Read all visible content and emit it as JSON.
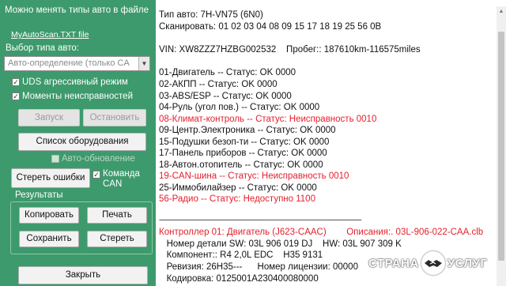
{
  "sidebar": {
    "hint_text": "Можно менять типы авто в файле",
    "hint_link": "MyAutoScan.TXT file",
    "type_label": "Выбор типа авто:",
    "type_select_value": "Авто-определение (только CA",
    "uds_checkbox_label": "UDS агрессивный режим",
    "uds_checked": true,
    "moments_checkbox_label": "Моменты неисправностей",
    "moments_checked": true,
    "start_button": "Запуск",
    "stop_button": "Остановить",
    "equipment_button": "Список оборудования",
    "auto_update_label": "Авто-обновление",
    "auto_update_checked": false,
    "clear_errors_button": "Стереть ошибки",
    "can_command_label": "Команда CAN",
    "can_command_checked": true,
    "results_group_label": "Результаты",
    "copy_button": "Копировать",
    "print_button": "Печать",
    "save_button": "Сохранить",
    "erase_button": "Стереть",
    "close_button": "Закрыть"
  },
  "log": {
    "car_type": "Тип авто: 7H-VN75 (6N0)",
    "scan_list": "Сканировать: 01 02 03 04 08 09 15 17 18 19 25 56 0B",
    "vin_line": "VIN: XW8ZZZ7HZBG002532    Пробег:: 187610km-116575miles",
    "modules": [
      {
        "text": "01-Двигатель -- Статус: OK 0000",
        "error": false
      },
      {
        "text": "02-АКПП -- Статус: OK 0000",
        "error": false
      },
      {
        "text": "03-ABS/ESP -- Статус: OK 0000",
        "error": false
      },
      {
        "text": "04-Руль (угол пов.) -- Статус: OK 0000",
        "error": false
      },
      {
        "text": "08-Климат-контроль -- Статус: Неисправность 0010",
        "error": true
      },
      {
        "text": "09-Центр.Электроника -- Статус: OK 0000",
        "error": false
      },
      {
        "text": "15-Подушки безоп-ти -- Статус: OK 0000",
        "error": false
      },
      {
        "text": "17-Панель приборов -- Статус: OK 0000",
        "error": false
      },
      {
        "text": "18-Автон.отопитель -- Статус: OK 0000",
        "error": false
      },
      {
        "text": "19-CAN-шина -- Статус: Неисправность 0010",
        "error": true
      },
      {
        "text": "25-Иммобилайзер -- Статус: OK 0000",
        "error": false
      },
      {
        "text": "56-Радио -- Статус: Недоступно 1100",
        "error": true
      }
    ],
    "separator": "--------------------------------------------------------------------------------------------------------------------------------",
    "controller_line": "Контроллер 01: Двигатель (J623-CAAC)        Описания:. 03L-906-022-CAA.clb",
    "details": [
      "   Номер детали SW: 03L 906 019 DJ    HW: 03L 907 309 K",
      "   Компонент:: R4 2,0L EDC    H35 9131",
      "   Ревизия: 26H35---      Номер лицензии: 00000",
      "   Кодировка: 0125001A230400080000"
    ]
  },
  "watermark": {
    "left_word": "СТРАНА",
    "right_word": "УСЛУГ"
  },
  "colors": {
    "panel_bg": "#3d9a6c",
    "error_text": "#e5202d",
    "normal_text": "#111111"
  }
}
